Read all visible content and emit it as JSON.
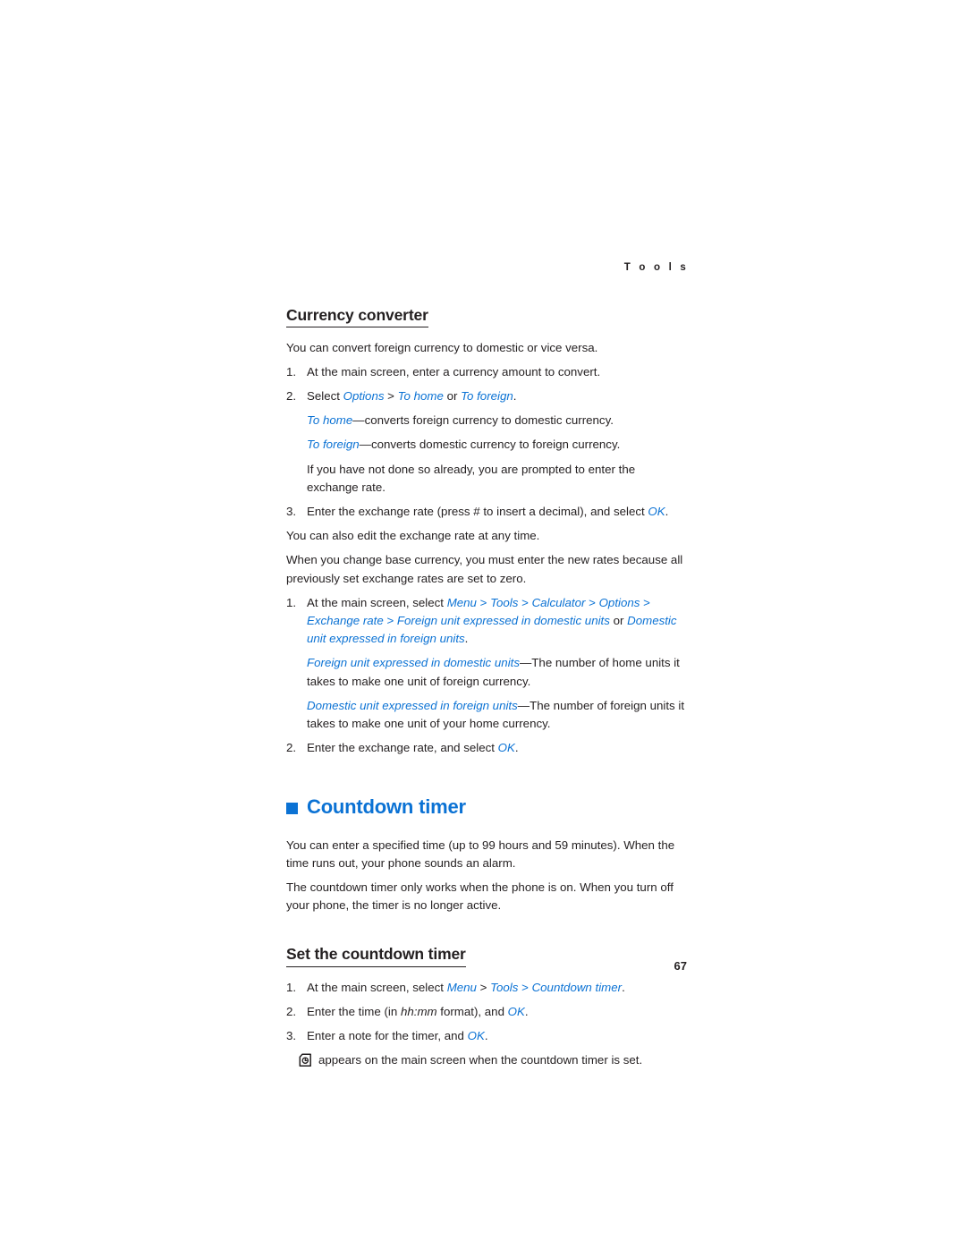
{
  "running_header": "T o o l s",
  "page_number": "67",
  "colors": {
    "ui_blue": "#0b72d4",
    "body_black": "#231f20"
  },
  "sections": {
    "currency_converter": {
      "heading": "Currency converter",
      "intro": "You can convert foreign currency to domestic or vice versa.",
      "step1_num": "1.",
      "step1_text": "At the main screen, enter a currency amount to convert.",
      "step2_num": "2.",
      "step2_prefix": "Select ",
      "step2_options": "Options",
      "step2_sep1": " > ",
      "step2_to_home": "To home",
      "step2_or": " or ",
      "step2_to_foreign": "To foreign",
      "step2_period": ".",
      "to_home_term": "To home",
      "to_home_def": "—converts foreign currency to domestic currency.",
      "to_foreign_term": "To foreign",
      "to_foreign_def": "—converts domestic currency to foreign currency.",
      "prompt_note": "If you have not done so already, you are prompted to enter the exchange rate.",
      "step3_num": "3.",
      "step3_prefix": "Enter the exchange rate (press # to insert a decimal), and select ",
      "step3_ok": "OK",
      "step3_period": ".",
      "edit_note": "You can also edit the exchange rate at any time.",
      "base_currency_note": "When you change base currency, you must enter the new rates because all previously set exchange rates are set to zero.",
      "rate_step1_num": "1.",
      "rate_step1_prefix": "At the main screen, select ",
      "rate_menu": "Menu",
      "rate_sep1": " > ",
      "rate_tools": "Tools",
      "rate_sep2": " > ",
      "rate_calculator": "Calculator",
      "rate_sep3": " > ",
      "rate_options": "Options",
      "rate_sep4": " > ",
      "rate_exchange_rate": "Exchange rate",
      "rate_sep5": " > ",
      "rate_foreign_unit": "Foreign unit expressed in domestic units",
      "rate_or": " or ",
      "rate_domestic_unit": "Domestic unit expressed in foreign units",
      "rate_period": ".",
      "foreign_term": "Foreign unit expressed in domestic units",
      "foreign_def": "—The number of home units it takes to make one unit of foreign currency.",
      "domestic_term": "Domestic unit expressed in foreign units",
      "domestic_def": "—The number of foreign units it takes to make one unit of your home currency.",
      "rate_step2_num": "2.",
      "rate_step2_prefix": "Enter the exchange rate, and select ",
      "rate_step2_ok": "OK",
      "rate_step2_period": "."
    },
    "countdown_timer": {
      "heading": "Countdown timer",
      "para1": "You can enter a specified time (up to 99 hours and 59 minutes). When the time runs out, your phone sounds an alarm.",
      "para2": "The countdown timer only works when the phone is on. When you turn off your phone, the timer is no longer active.",
      "sub_heading": "Set the countdown timer",
      "step1_num": "1.",
      "step1_prefix": "At the main screen, select ",
      "step1_menu": "Menu",
      "step1_sep1": " > ",
      "step1_tools": "Tools",
      "step1_sep2": " > ",
      "step1_countdown": "Countdown timer",
      "step1_period": ".",
      "step2_num": "2.",
      "step2_prefix": "Enter the time (in ",
      "step2_format": "hh:mm",
      "step2_mid": " format), and ",
      "step2_ok": "OK",
      "step2_period": ".",
      "step3_num": "3.",
      "step3_prefix": "Enter a note for the timer, and ",
      "step3_ok": "OK",
      "step3_period": ".",
      "icon_name": "countdown-timer-icon",
      "icon_note": "appears on the main screen when the countdown timer is set."
    }
  }
}
